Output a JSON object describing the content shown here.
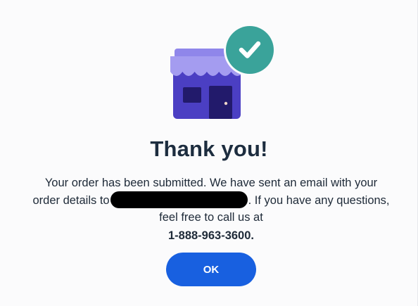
{
  "dialog": {
    "title": "Thank you!",
    "message_line1": "Your order has been submitted. We have sent an email with your",
    "message_line2_start": "order details to",
    "message_line2_end": ". If you have any questions,",
    "message_line3": "feel free to call us at",
    "phone": "1-888-963-3600.",
    "ok_label": "OK"
  },
  "icons": {
    "illustration": "store-icon",
    "badge": "check-circle-icon"
  },
  "colors": {
    "title": "#1d2d3f",
    "button": "#1860e0",
    "badge": "#3aa39a",
    "store_body": "#4b3fc3",
    "awning": "#a49cf0"
  }
}
